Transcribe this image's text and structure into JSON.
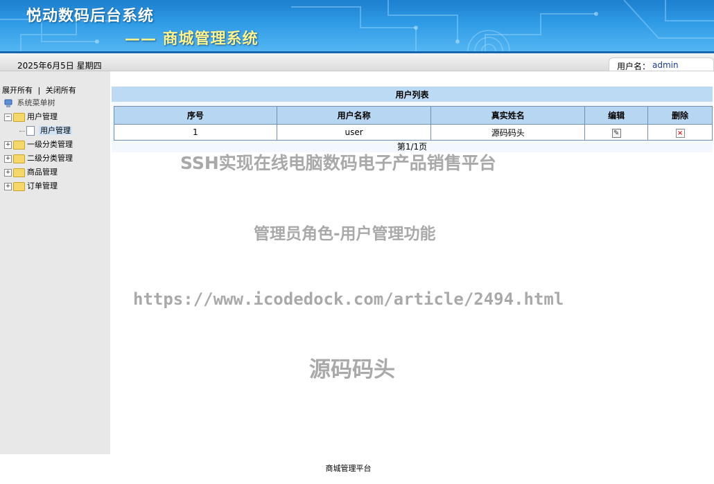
{
  "header": {
    "title": "悦动数码后台系统",
    "subtitle": "—— 商城管理系统"
  },
  "infobar": {
    "date": "2025年6月5日 星期四",
    "user_label": "用户名：",
    "username": "admin"
  },
  "sidebar": {
    "expand_all": "展开所有",
    "separator": "|",
    "collapse_all": "关闭所有",
    "root": "系统菜单树",
    "items": [
      {
        "label": "用户管理",
        "toggle": "−",
        "children": [
          {
            "label": "用户管理"
          }
        ]
      },
      {
        "label": "一级分类管理",
        "toggle": "+"
      },
      {
        "label": "二级分类管理",
        "toggle": "+"
      },
      {
        "label": "商品管理",
        "toggle": "+"
      },
      {
        "label": "订单管理",
        "toggle": "+"
      }
    ]
  },
  "main": {
    "panel_title": "用户列表",
    "columns": [
      "序号",
      "用户名称",
      "真实姓名",
      "编辑",
      "删除"
    ],
    "rows": [
      {
        "index": "1",
        "username": "user",
        "realname": "源码码头"
      }
    ],
    "pager": "第1/1页"
  },
  "watermark": {
    "line1": "SSH实现在线电脑数码电子产品销售平台",
    "line2": "管理员角色-用户管理功能",
    "line3": "https://www.icodedock.com/article/2494.html",
    "line4": "源码码头"
  },
  "footer": {
    "text": "商城管理平台"
  },
  "colors": {
    "banner": "#2f9be6",
    "panel_title_bg": "#bcdaf4",
    "sidebar_bg": "#e8e8e8"
  }
}
